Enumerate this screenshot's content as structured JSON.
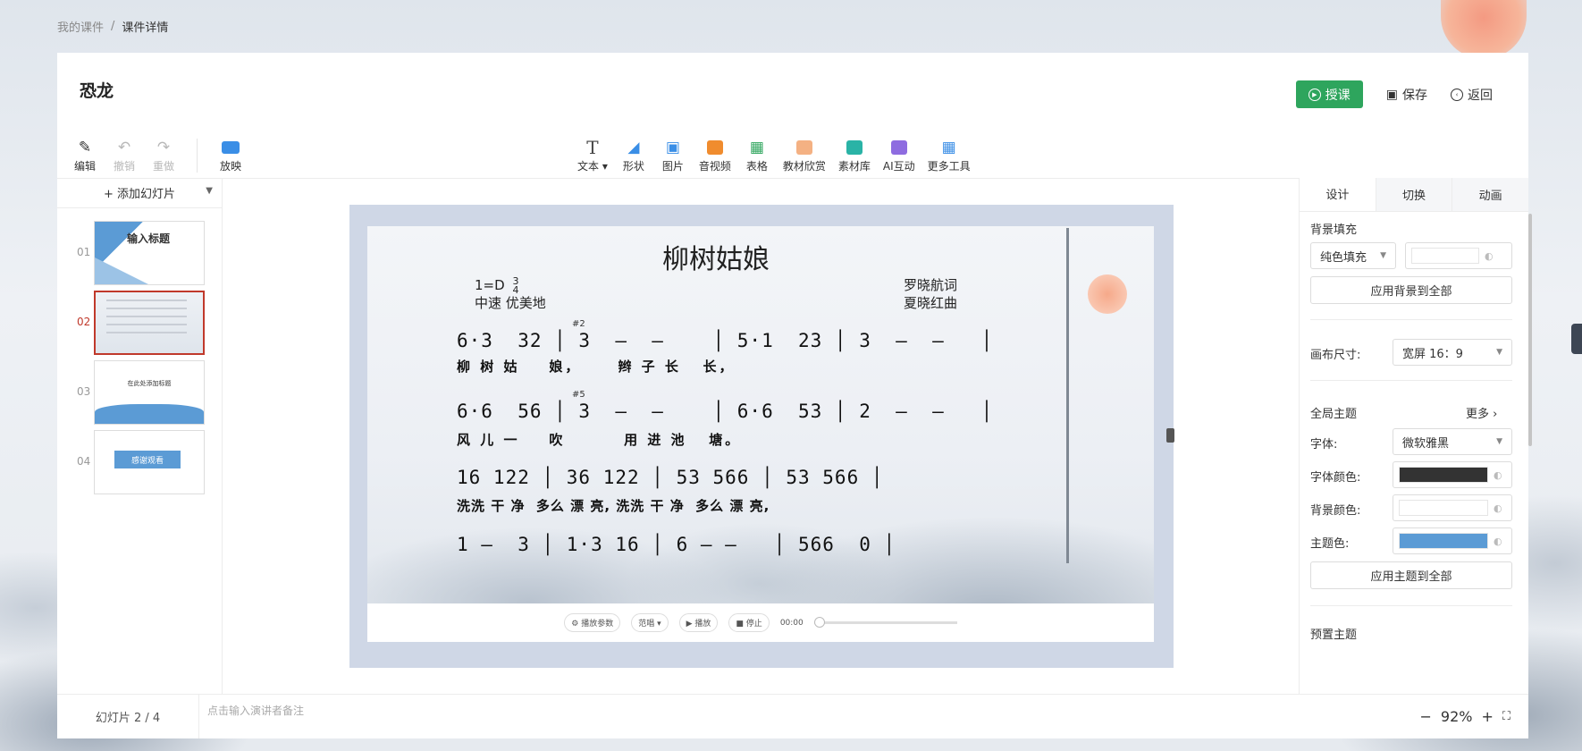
{
  "breadcrumb": {
    "parent": "我的课件",
    "separator": "/",
    "current": "课件详情"
  },
  "header": {
    "title": "恐龙",
    "teach_label": "授课",
    "save_label": "保存",
    "back_label": "返回"
  },
  "toolbar_left": [
    {
      "label": "编辑",
      "icon": "pen-icon",
      "glyph": "✎"
    },
    {
      "label": "撤销",
      "icon": "undo-icon",
      "glyph": "↶"
    },
    {
      "label": "重做",
      "icon": "redo-icon",
      "glyph": "↷"
    },
    {
      "label": "放映",
      "icon": "camera-icon",
      "glyph": "▶"
    }
  ],
  "toolbar_center": [
    {
      "label": "文本",
      "icon": "text-icon",
      "glyph": "T"
    },
    {
      "label": "形状",
      "icon": "shape-icon",
      "glyph": "◢"
    },
    {
      "label": "图片",
      "icon": "image-icon",
      "glyph": "▣"
    },
    {
      "label": "音视频",
      "icon": "media-icon",
      "glyph": "▶"
    },
    {
      "label": "表格",
      "icon": "table-icon",
      "glyph": "▦"
    },
    {
      "label": "教材欣赏",
      "icon": "book-icon",
      "glyph": "◫"
    },
    {
      "label": "素材库",
      "icon": "folder-icon",
      "glyph": "▤"
    },
    {
      "label": "AI互动",
      "icon": "ai-icon",
      "glyph": "◉"
    },
    {
      "label": "更多工具",
      "icon": "grid-icon",
      "glyph": "▦"
    }
  ],
  "colors": {
    "primary_green": "#2ea55d",
    "active_red": "#c0392b",
    "theme_blue": "#5b9bd5",
    "font_color": "#333333"
  },
  "slides_panel": {
    "add_label": "+ 添加幻灯片",
    "items": [
      {
        "num": "01",
        "text": "输入标题"
      },
      {
        "num": "02",
        "text": ""
      },
      {
        "num": "03",
        "text": "在此处添加标题"
      },
      {
        "num": "04",
        "text": "感谢观看"
      }
    ]
  },
  "slide": {
    "title": "柳树姑娘",
    "key": "1=D",
    "time_sig_top": "3",
    "time_sig_bottom": "4",
    "tempo": "中速 优美地",
    "lyricist": "罗晓航词",
    "composer": "夏晓红曲",
    "rows": [
      {
        "notes": "6·3  32 │ 3  –  –    │ 5·1  23 │ 3  –  –   │",
        "lyrics": "柳 树 姑    娘，     辫 子 长   长，",
        "grace": "#2"
      },
      {
        "notes": "6·6  56 │ 3  –  –    │ 6·6  53 │ 2  –  –   │",
        "lyrics": "风 儿 一    吹        用 进 池   塘。",
        "grace": "#5"
      },
      {
        "notes": "16 122 │ 36 122 │ 53 566 │ 53 566 │",
        "lyrics": "洗洗 干 净  多么 漂 亮, 洗洗 干 净  多么 漂 亮,",
        "grace": ""
      },
      {
        "notes": "1 –  3 │ 1·3 16 │ 6 – –   │ 566  0 │",
        "lyrics": "",
        "grace": ""
      }
    ]
  },
  "player": {
    "params_label": "播放参数",
    "mode_label": "范唱",
    "play_label": "播放",
    "stop_label": "停止",
    "time": "00:00"
  },
  "right_panel": {
    "tabs": [
      "设计",
      "切换",
      "动画"
    ],
    "bg_fill_label": "背景填充",
    "bg_fill_value": "纯色填充",
    "apply_bg_label": "应用背景到全部",
    "canvas_size_label": "画布尺寸:",
    "canvas_size_value": "宽屏 16：9",
    "global_theme_label": "全局主题",
    "more_label": "更多",
    "font_label": "字体:",
    "font_value": "微软雅黑",
    "font_color_label": "字体颜色:",
    "bg_color_label": "背景颜色:",
    "theme_color_label": "主题色:",
    "apply_theme_label": "应用主题到全部",
    "preset_theme_label": "预置主题"
  },
  "footer": {
    "slide_counter": "幻灯片 2 / 4",
    "note_placeholder": "点击输入演讲者备注",
    "zoom": "92%"
  }
}
